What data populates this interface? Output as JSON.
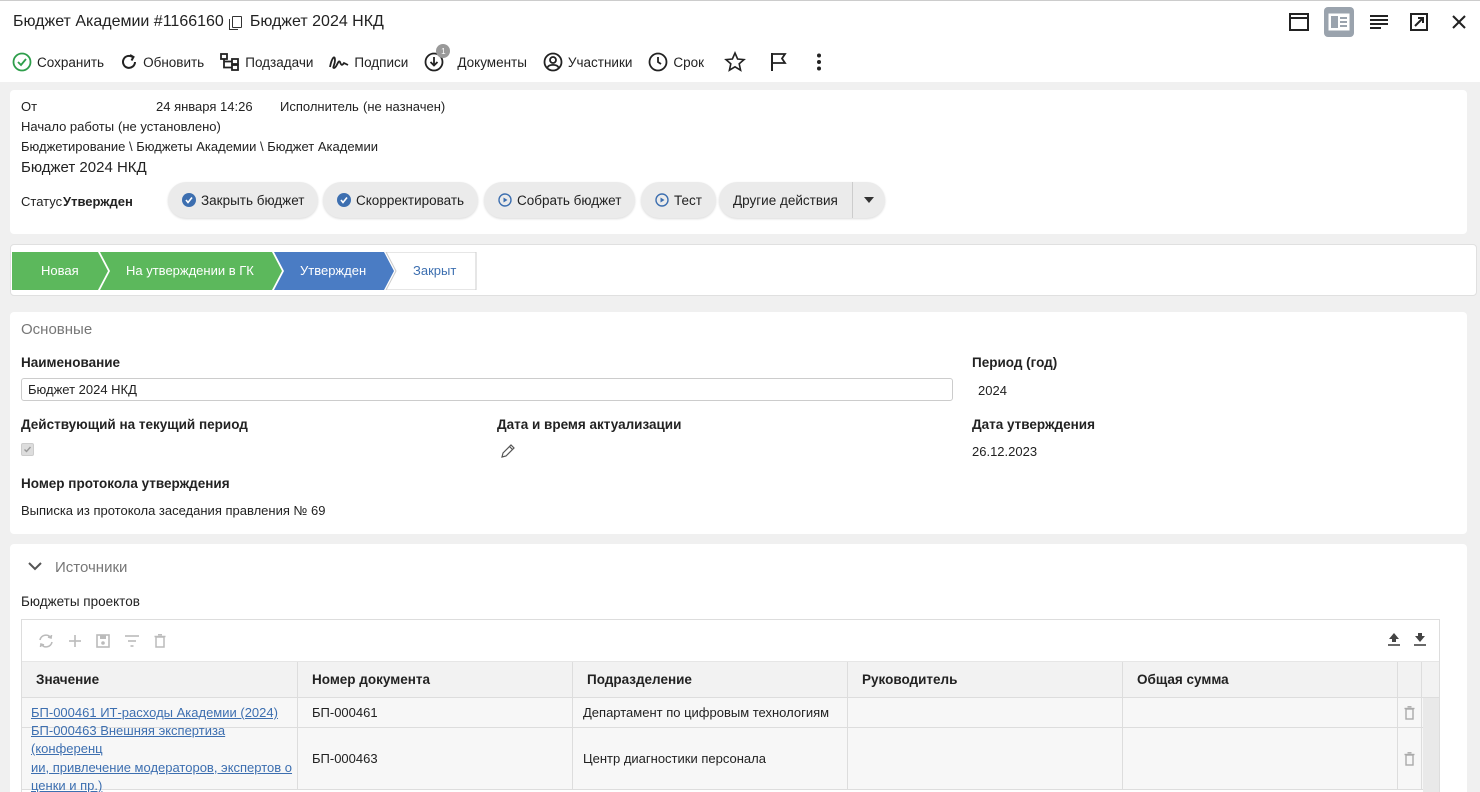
{
  "window": {
    "title_left": "Бюджет Академии #1166160",
    "title_right": "Бюджет 2024 НКД"
  },
  "toolbar": {
    "save": "Сохранить",
    "refresh": "Обновить",
    "subtasks": "Подзадачи",
    "signatures": "Подписи",
    "documents_count": "1",
    "documents": "Документы",
    "participants": "Участники",
    "deadline": "Срок"
  },
  "header": {
    "from_label": "От",
    "from_date": "24 января 14:26",
    "assignee_label": "Исполнитель",
    "assignee_value": "(не назначен)",
    "start_label": "Начало работы",
    "start_value": "(не установлено)",
    "breadcrumb": "Бюджетирование \\ Бюджеты Академии \\ Бюджет Академии",
    "doc_title": "Бюджет 2024 НКД",
    "status_label": "Статус",
    "status_value": "Утвержден",
    "actions": [
      "Закрыть бюджет",
      "Скорректировать",
      "Собрать бюджет",
      "Тест",
      "Другие действия"
    ]
  },
  "stages": [
    "Новая",
    "На утверждении в ГК",
    "Утвержден",
    "Закрыт"
  ],
  "colors": {
    "stage_done": "#5cb85c",
    "stage_current": "#4a7cc4",
    "accent": "#3d6fb0"
  },
  "main": {
    "section": "Основные",
    "name_label": "Наименование",
    "name_value": "Бюджет 2024 НКД",
    "period_label": "Период (год)",
    "period_value": "2024",
    "current_label": "Действующий на текущий период",
    "actualization_label": "Дата и время актуализации",
    "approval_date_label": "Дата утверждения",
    "approval_date_value": "26.12.2023",
    "protocol_label": "Номер протокола утверждения",
    "protocol_value": "Выписка из протокола заседания правления № 69"
  },
  "sources": {
    "section": "Источники",
    "sub": "Бюджеты проектов",
    "columns": [
      "Значение",
      "Номер документа",
      "Подразделение",
      "Руководитель",
      "Общая сумма"
    ],
    "rows": [
      {
        "value": "БП-000461 ИТ-расходы Академии (2024)",
        "doc": "БП-000461",
        "dept": "Департамент по цифровым технологиям",
        "head": "",
        "sum": ""
      },
      {
        "value_l1": "БП-000463 Внешняя экспертиза (конференц",
        "value_l2": "ии, привлечение модераторов, экспертов о",
        "value_l3": "ценки и пр.)",
        "doc": "БП-000463",
        "dept": "Центр диагностики персонала",
        "head": "",
        "sum": ""
      }
    ]
  }
}
